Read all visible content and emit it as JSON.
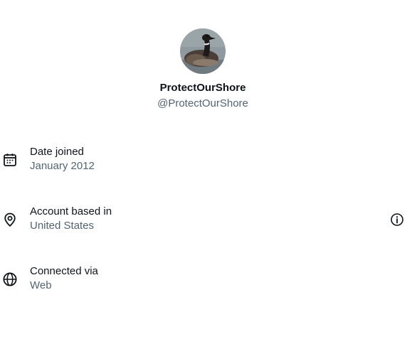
{
  "profile": {
    "display_name": "ProtectOurShore",
    "handle": "@ProtectOurShore",
    "avatar_icon": "brant-goose-avatar"
  },
  "rows": [
    {
      "icon": "calendar-icon",
      "label": "Date joined",
      "value": "January 2012"
    },
    {
      "icon": "location-pin-icon",
      "label": "Account based in",
      "value": "United States",
      "trailing_icon": "info-icon"
    },
    {
      "icon": "globe-icon",
      "label": "Connected via",
      "value": "Web"
    }
  ],
  "colors": {
    "primary_text": "#0f1419",
    "secondary_text": "#536471",
    "background": "#ffffff"
  }
}
